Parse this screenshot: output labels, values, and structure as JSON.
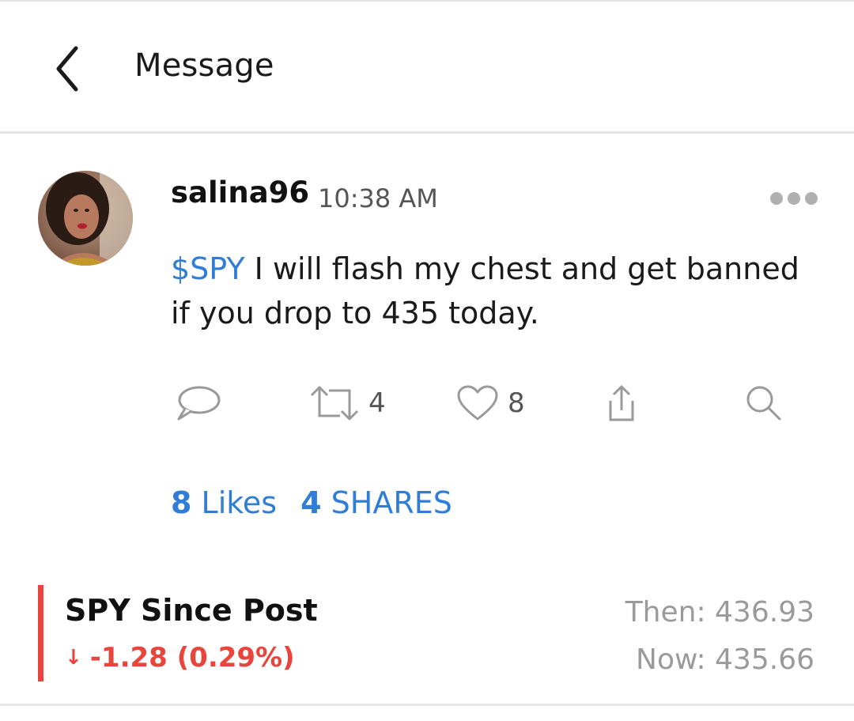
{
  "header": {
    "title": "Message",
    "back_icon": "chevron-left-icon"
  },
  "post": {
    "username": "salina96",
    "time": "10:38 AM",
    "cashtag": "$SPY",
    "text": " I will flash my chest and get banned if you drop to 435 today.",
    "more_icon": "more-horizontal-icon"
  },
  "actions": {
    "reply_icon": "comment-icon",
    "reshare_icon": "reshare-icon",
    "reshare_count": "4",
    "like_icon": "heart-icon",
    "like_count": "8",
    "share_icon": "share-upload-icon",
    "search_icon": "search-icon"
  },
  "stats": {
    "likes_count": "8",
    "likes_label": "Likes",
    "shares_count": "4",
    "shares_label": "SHARES"
  },
  "since_post": {
    "title": "SPY Since Post",
    "arrow": "↓",
    "change": "-1.28 (0.29%)",
    "then": "Then: 436.93",
    "now": "Now: 435.66"
  },
  "colors": {
    "accent_blue": "#2f7dd6",
    "negative_red": "#e8453c",
    "muted_gray": "#9a9a9a"
  }
}
